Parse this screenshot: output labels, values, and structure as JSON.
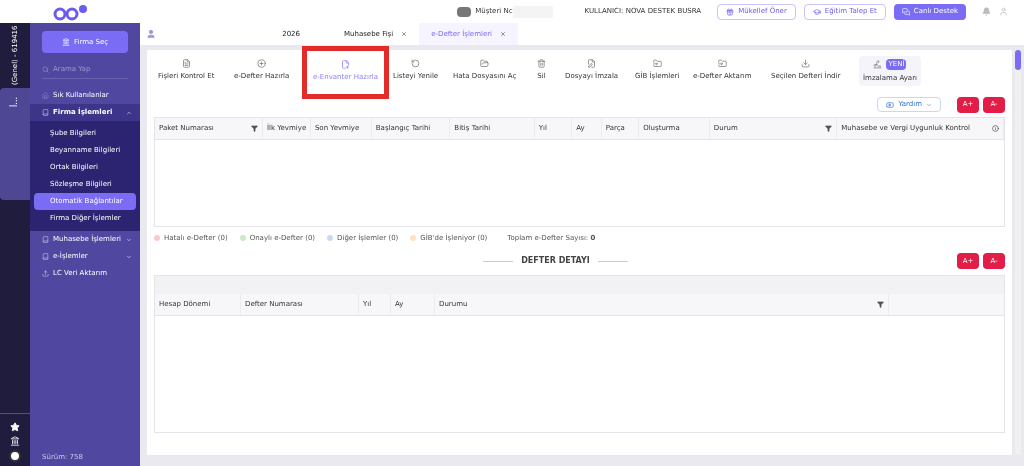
{
  "header": {
    "customer_label": "Müşteri Nc",
    "user": "KULLANICI: NOVA DESTEK BUSRA",
    "buttons": [
      {
        "label": "Mükellef Öner",
        "kind": "outline"
      },
      {
        "label": "Eğitim Talep Et",
        "kind": "outline"
      },
      {
        "label": "Canlı Destek",
        "kind": "solid"
      }
    ]
  },
  "rail": {
    "company": "(Genel) - 619416",
    "label": "İ..."
  },
  "sidebar": {
    "select_button": "Firma Seç",
    "search_placeholder": "Arama Yap",
    "version": "Sürüm: 758",
    "items": [
      {
        "label": "Sık Kullanılanlar",
        "expanded": false,
        "has_children": false
      },
      {
        "label": "Firma İşlemleri",
        "expanded": true,
        "has_children": true,
        "children": [
          {
            "label": "Şube Bilgileri",
            "selected": false
          },
          {
            "label": "Beyanname Bilgileri",
            "selected": false
          },
          {
            "label": "Ortak Bilgileri",
            "selected": false
          },
          {
            "label": "Sözleşme Bilgileri",
            "selected": false
          },
          {
            "label": "Otomatik Bağlantılar",
            "selected": true
          },
          {
            "label": "Firma Diğer İşlemler",
            "selected": false
          }
        ]
      },
      {
        "label": "Muhasebe İşlemleri",
        "expanded": false,
        "has_children": true
      },
      {
        "label": "e-İşlemler",
        "expanded": false,
        "has_children": true
      },
      {
        "label": "LC Veri Aktarım",
        "expanded": false,
        "has_children": false
      }
    ]
  },
  "tabs": [
    {
      "label": "2026",
      "closable": false,
      "selected": false
    },
    {
      "label": "Muhasebe Fişi",
      "closable": true,
      "selected": false
    },
    {
      "label": "e-Defter İşlemleri",
      "closable": true,
      "selected": true
    }
  ],
  "toolbar": [
    {
      "label": "Fişleri Kontrol Et",
      "highlighted": false
    },
    {
      "label": "e-Defter Hazırla",
      "highlighted": false
    },
    {
      "label": "e-Envanter Hazırla",
      "highlighted": true
    },
    {
      "label": "Listeyi Yenile",
      "highlighted": false
    },
    {
      "label": "Hata Dosyasını Aç",
      "highlighted": false
    },
    {
      "label": "Sil",
      "highlighted": false
    },
    {
      "label": "Dosyayı İmzala",
      "highlighted": false
    },
    {
      "label": "GİB İşlemleri",
      "highlighted": false
    },
    {
      "label": "e-Defter Aktarım",
      "highlighted": false
    },
    {
      "label": "Seçilen Defteri İndir",
      "highlighted": false
    },
    {
      "label": "İmzalama Ayarı",
      "highlighted": false,
      "badge": "YENİ"
    }
  ],
  "help_button": "Yardım",
  "font_buttons": [
    "A+",
    "A-"
  ],
  "table": {
    "columns": [
      {
        "label": "Paket Numarası",
        "filter": true
      },
      {
        "label": "İlk Yevmiye",
        "filter": false
      },
      {
        "label": "Son Yevmiye",
        "filter": false
      },
      {
        "label": "Başlangıç Tarihi",
        "filter": false
      },
      {
        "label": "Bitiş Tarihi",
        "filter": false
      },
      {
        "label": "Yıl",
        "filter": false
      },
      {
        "label": "Ay",
        "filter": false
      },
      {
        "label": "Parça",
        "filter": false
      },
      {
        "label": "Oluşturma",
        "filter": false
      },
      {
        "label": "Durum",
        "filter": true
      },
      {
        "label": "Muhasebe ve Vergi Uygunluk Kontrol",
        "filter": false
      }
    ]
  },
  "legend": [
    {
      "label": "Hatalı e-Defter (0)",
      "color": "#f9c9d3"
    },
    {
      "label": "Onaylı e-Defter (0)",
      "color": "#c9ecc3"
    },
    {
      "label": "Diğer İşlemler (0)",
      "color": "#c9d9f5"
    },
    {
      "label": "GİB'de İşleniyor (0)",
      "color": "#fde2c4"
    }
  ],
  "total": "Toplam e-Defter Sayısı: **0**",
  "detail": {
    "title": "DEFTER DETAYI",
    "font_buttons": [
      "A+",
      "A-"
    ],
    "columns": [
      {
        "label": "Hesap Dönemi",
        "filter": false
      },
      {
        "label": "Defter Numarası",
        "filter": false
      },
      {
        "label": "Yıl",
        "filter": false
      },
      {
        "label": "Ay",
        "filter": false
      },
      {
        "label": "Durumu",
        "filter": true
      }
    ]
  }
}
